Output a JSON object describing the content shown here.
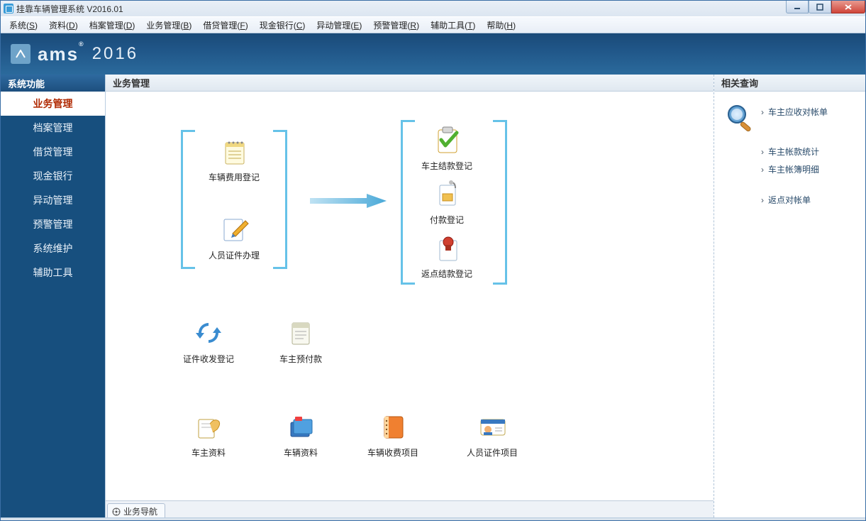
{
  "window": {
    "title": "挂靠车辆管理系统 V2016.01"
  },
  "menu": [
    {
      "label": "系统",
      "key": "S"
    },
    {
      "label": "资料",
      "key": "D"
    },
    {
      "label": "档案管理",
      "key": "D"
    },
    {
      "label": "业务管理",
      "key": "B"
    },
    {
      "label": "借贷管理",
      "key": "F"
    },
    {
      "label": "现金银行",
      "key": "C"
    },
    {
      "label": "异动管理",
      "key": "E"
    },
    {
      "label": "预警管理",
      "key": "R"
    },
    {
      "label": "辅助工具",
      "key": "T"
    },
    {
      "label": "帮助",
      "key": "H"
    }
  ],
  "brand": {
    "name": "ams",
    "reg": "®",
    "year": "2016"
  },
  "sidebar": {
    "title": "系统功能",
    "items": [
      {
        "label": "业务管理",
        "active": true
      },
      {
        "label": "档案管理"
      },
      {
        "label": "借贷管理"
      },
      {
        "label": "现金银行"
      },
      {
        "label": "异动管理"
      },
      {
        "label": "预警管理"
      },
      {
        "label": "系统维护"
      },
      {
        "label": "辅助工具"
      }
    ]
  },
  "center": {
    "title": "业务管理",
    "flow_left": [
      {
        "label": "车辆费用登记",
        "icon": "notepad"
      },
      {
        "label": "人员证件办理",
        "icon": "edit-doc"
      }
    ],
    "flow_right": [
      {
        "label": "车主结款登记",
        "icon": "clipboard-check"
      },
      {
        "label": "付款登记",
        "icon": "pay-doc"
      },
      {
        "label": "返点结款登记",
        "icon": "stamp-doc"
      }
    ],
    "row2": [
      {
        "label": "证件收发登记",
        "icon": "sync"
      },
      {
        "label": "车主预付款",
        "icon": "calendar-doc"
      }
    ],
    "row3": [
      {
        "label": "车主资料",
        "icon": "hand-doc"
      },
      {
        "label": "车辆资料",
        "icon": "folders"
      },
      {
        "label": "车辆收费项目",
        "icon": "notebook"
      },
      {
        "label": "人员证件项目",
        "icon": "id-card"
      }
    ]
  },
  "right": {
    "title": "相关查询",
    "links_a": [
      "车主应收对帐单",
      "车主帐款统计",
      "车主帐簿明细"
    ],
    "links_b": [
      "返点对帐单"
    ]
  },
  "tab": {
    "label": "业务导航"
  }
}
